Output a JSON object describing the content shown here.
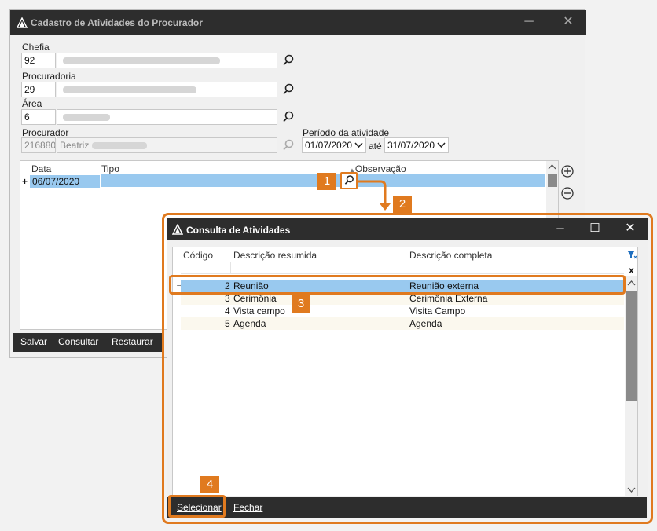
{
  "main_window": {
    "title": "Cadastro de Atividades do Procurador",
    "chefia": {
      "label": "Chefia",
      "code": "92"
    },
    "procuradoria": {
      "label": "Procuradoria",
      "code": "29"
    },
    "area": {
      "label": "Área",
      "code": "6"
    },
    "procurador": {
      "label": "Procurador",
      "code": "216880",
      "name": "Beatriz"
    },
    "periodo": {
      "label": "Período da atividade",
      "start": "01/07/2020",
      "separator": "até",
      "end": "31/07/2020"
    },
    "grid": {
      "headers": {
        "date": "Data",
        "type": "Tipo",
        "observation": "Observação"
      },
      "rows": [
        {
          "marker": "+",
          "date": "06/07/2020"
        }
      ]
    },
    "toolbar": {
      "save": "Salvar",
      "query": "Consultar",
      "restore": "Restaurar"
    }
  },
  "dialog": {
    "title": "Consulta de Atividades",
    "headers": {
      "code": "Código",
      "short": "Descrição resumida",
      "full": "Descrição completa"
    },
    "current_marker": "→",
    "clear_filter": "x",
    "rows": [
      {
        "code": "2",
        "short": "Reunião",
        "full": "Reunião externa"
      },
      {
        "code": "3",
        "short": "Cerimônia",
        "full": "Cerimônia Externa"
      },
      {
        "code": "4",
        "short": "Vista campo",
        "full": "Visita Campo"
      },
      {
        "code": "5",
        "short": "Agenda",
        "full": "Agenda"
      }
    ],
    "toolbar": {
      "select": "Selecionar",
      "close": "Fechar"
    }
  },
  "badges": [
    "1",
    "2",
    "3",
    "4"
  ],
  "icons": {
    "close": "✕",
    "minimize": "─",
    "maximize": "☐"
  },
  "colors": {
    "accent": "#e07a1f",
    "selection": "#99c9ef",
    "titlebar": "#2d2d2d"
  }
}
